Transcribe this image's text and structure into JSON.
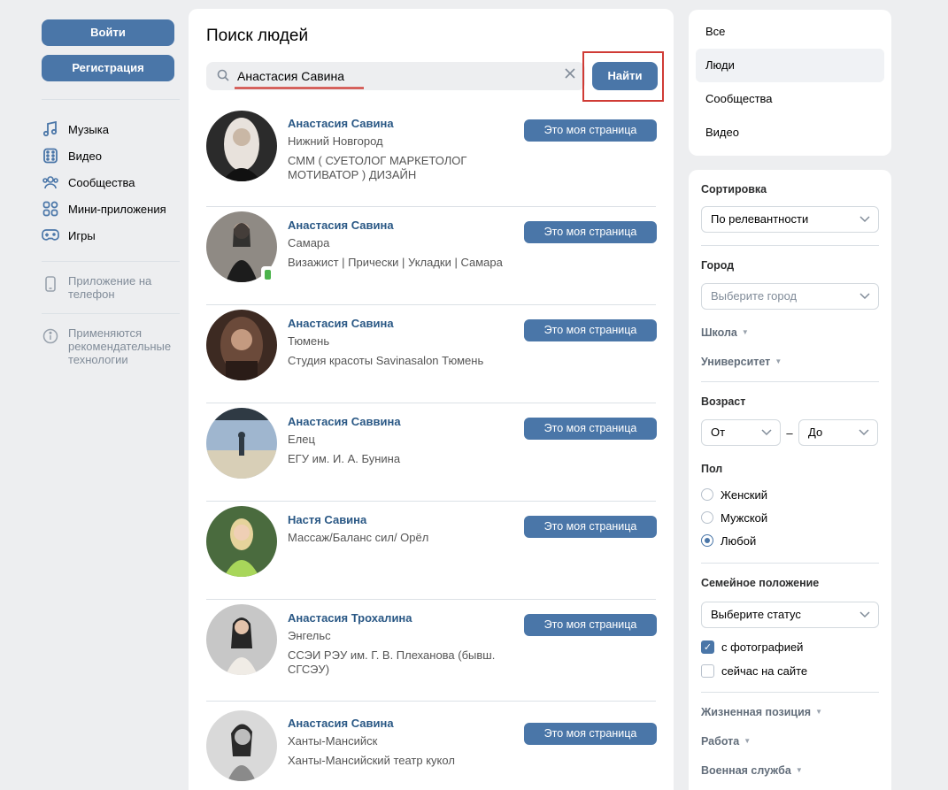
{
  "left": {
    "login_label": "Войти",
    "register_label": "Регистрация",
    "nav": [
      {
        "label": "Музыка",
        "icon": "music-icon"
      },
      {
        "label": "Видео",
        "icon": "video-icon"
      },
      {
        "label": "Сообщества",
        "icon": "communities-icon"
      },
      {
        "label": "Мини-приложения",
        "icon": "mini-apps-icon"
      },
      {
        "label": "Игры",
        "icon": "games-icon"
      }
    ],
    "app_phone": "Приложение на телефон",
    "recommend": "Применяются рекомендательные технологии"
  },
  "main": {
    "title": "Поиск людей",
    "search_value": "Анастасия Савина",
    "find_label": "Найти",
    "my_page_label": "Это моя страница",
    "results": [
      {
        "name": "Анастасия Савина",
        "lines": [
          "Нижний Новгород",
          "СММ ( СУЕТОЛОГ МАРКЕТОЛОГ МОТИВАТОР ) ДИЗАЙН"
        ],
        "colors": [
          "#2b2b2b",
          "#e8e2dc",
          "#c9b7a5"
        ]
      },
      {
        "name": "Анастасия Савина",
        "lines": [
          "Самара",
          "Визажист | Прически | Укладки | Самара"
        ],
        "colors": [
          "#8f8a84",
          "#1c1c1c",
          "#e9c9b2"
        ]
      },
      {
        "name": "Анастасия Савина",
        "lines": [
          "Тюмень",
          "Студия красоты Savinasalon Тюмень"
        ],
        "colors": [
          "#6b4a3a",
          "#c49a80",
          "#3d2a22"
        ]
      },
      {
        "name": "Анастасия Саввина",
        "lines": [
          "Елец",
          "ЕГУ им. И. А. Бунина"
        ],
        "colors": [
          "#9fb6cf",
          "#2f3a44",
          "#d8cfb7"
        ]
      },
      {
        "name": "Настя Савина",
        "lines": [
          "Массаж/Баланс сил/ Орёл"
        ],
        "colors": [
          "#4a6b3e",
          "#a8d65a",
          "#e5d39b"
        ]
      },
      {
        "name": "Анастасия Трохалина",
        "lines": [
          "Энгельс",
          "ССЭИ РЭУ им. Г. В. Плеханова (бывш. СГСЭУ)"
        ],
        "colors": [
          "#c7c7c7",
          "#262626",
          "#f0ece6"
        ]
      },
      {
        "name": "Анастасия Савина",
        "lines": [
          "Ханты-Мансийск",
          "Ханты-Мансийский театр кукол"
        ],
        "colors": [
          "#d9d9d9",
          "#2a2a2a",
          "#8a8a8a"
        ]
      }
    ]
  },
  "tabs": [
    "Все",
    "Люди",
    "Сообщества",
    "Видео"
  ],
  "filters": {
    "sort_label": "Сортировка",
    "sort_value": "По релевантности",
    "city_label": "Город",
    "city_placeholder": "Выберите город",
    "school_label": "Школа",
    "university_label": "Университет",
    "age_label": "Возраст",
    "age_from": "От",
    "age_dash": "–",
    "age_to": "До",
    "gender_label": "Пол",
    "gender_options": [
      "Женский",
      "Мужской",
      "Любой"
    ],
    "family_label": "Семейное положение",
    "family_placeholder": "Выберите статус",
    "with_photo": "с фотографией",
    "online_now": "сейчас на сайте",
    "life_position": "Жизненная позиция",
    "work": "Работа",
    "military": "Военная служба"
  },
  "colors": {
    "accent": "#4a76a8",
    "link": "#2a5885",
    "highlight": "#d03b35"
  }
}
